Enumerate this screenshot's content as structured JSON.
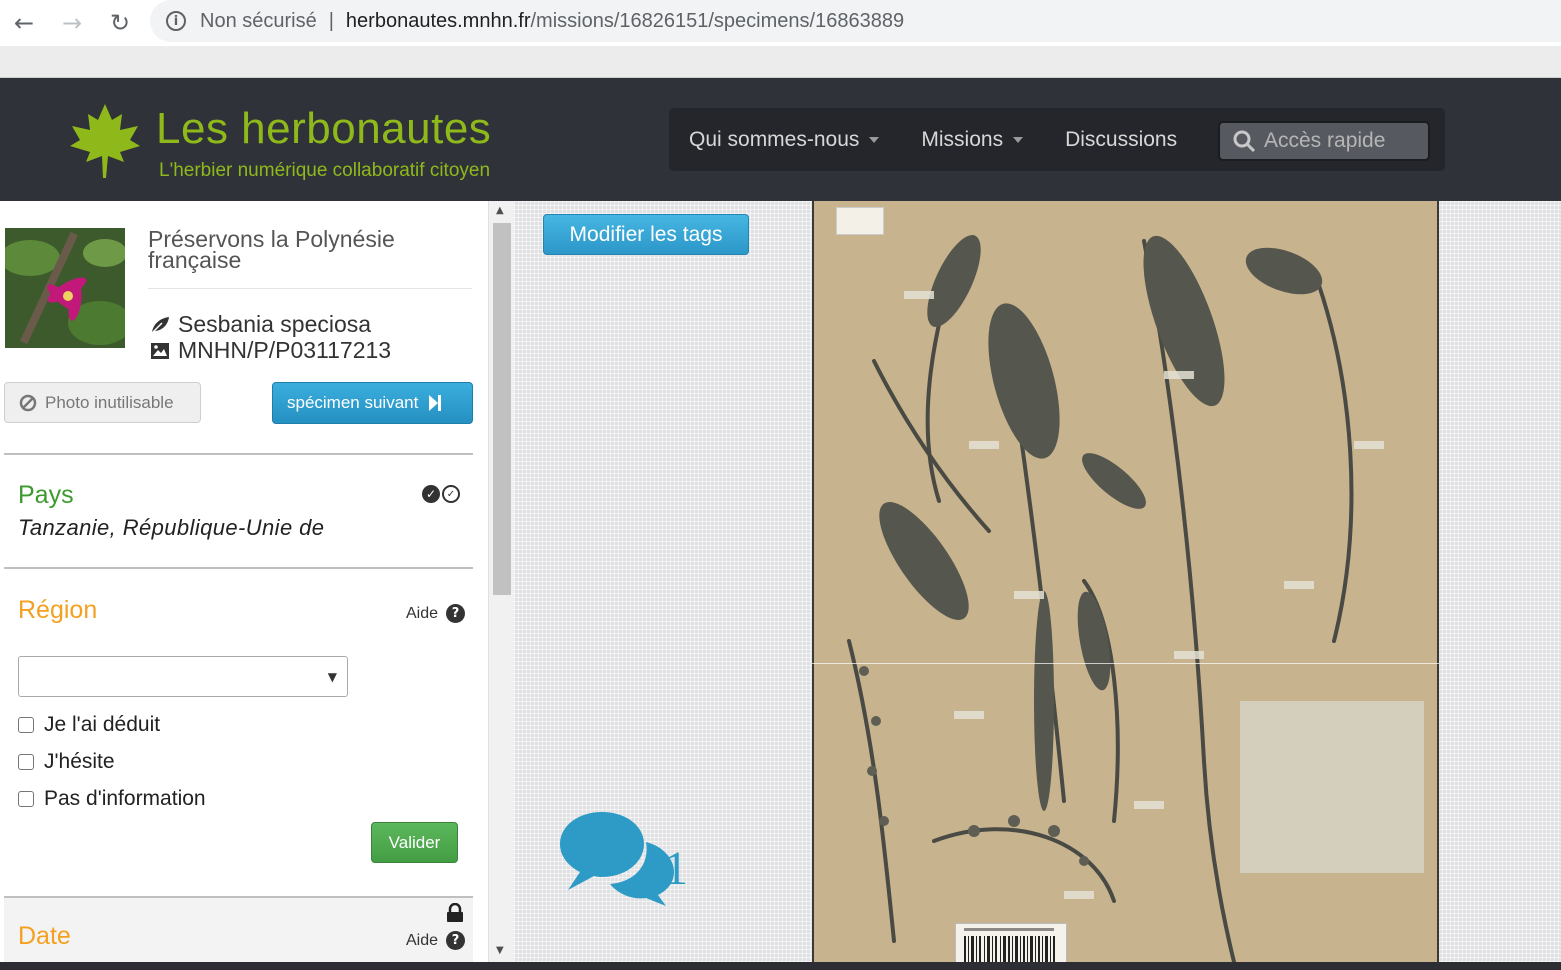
{
  "browser": {
    "security_label": "Non sécurisé",
    "url_host": "herbonautes.mnhn.fr",
    "url_path": "/missions/16826151/specimens/16863889"
  },
  "header": {
    "site_title": "Les herbonautes",
    "site_subtitle": "L'herbier numérique collaboratif citoyen",
    "nav": [
      {
        "label": "Qui sommes-nous",
        "dropdown": true
      },
      {
        "label": "Missions",
        "dropdown": true
      },
      {
        "label": "Discussions",
        "dropdown": false
      }
    ],
    "search_placeholder": "Accès rapide"
  },
  "specimen_info": {
    "mission_title": "Préservons la Polynésie française",
    "species": "Sesbania speciosa",
    "specimen_code": "MNHN/P/P03117213",
    "unusable_photo_label": "Photo inutilisable",
    "next_specimen_label": "spécimen suivant"
  },
  "country": {
    "label": "Pays",
    "value": "Tanzanie, République-Unie de"
  },
  "region": {
    "label": "Région",
    "help_label": "Aide",
    "selected": "",
    "options": [
      "Je l'ai déduit",
      "J'hésite",
      "Pas d'information"
    ],
    "validate_label": "Valider"
  },
  "date": {
    "label": "Date",
    "help_label": "Aide"
  },
  "viewer": {
    "edit_tags_label": "Modifier les tags",
    "discussion_count": "1",
    "accent_color": "#2e9bc6"
  },
  "colors": {
    "brand_green": "#8fb91b",
    "header_bg": "#2f3238",
    "section_done": "#3c9a2e",
    "section_todo": "#f4a020"
  }
}
